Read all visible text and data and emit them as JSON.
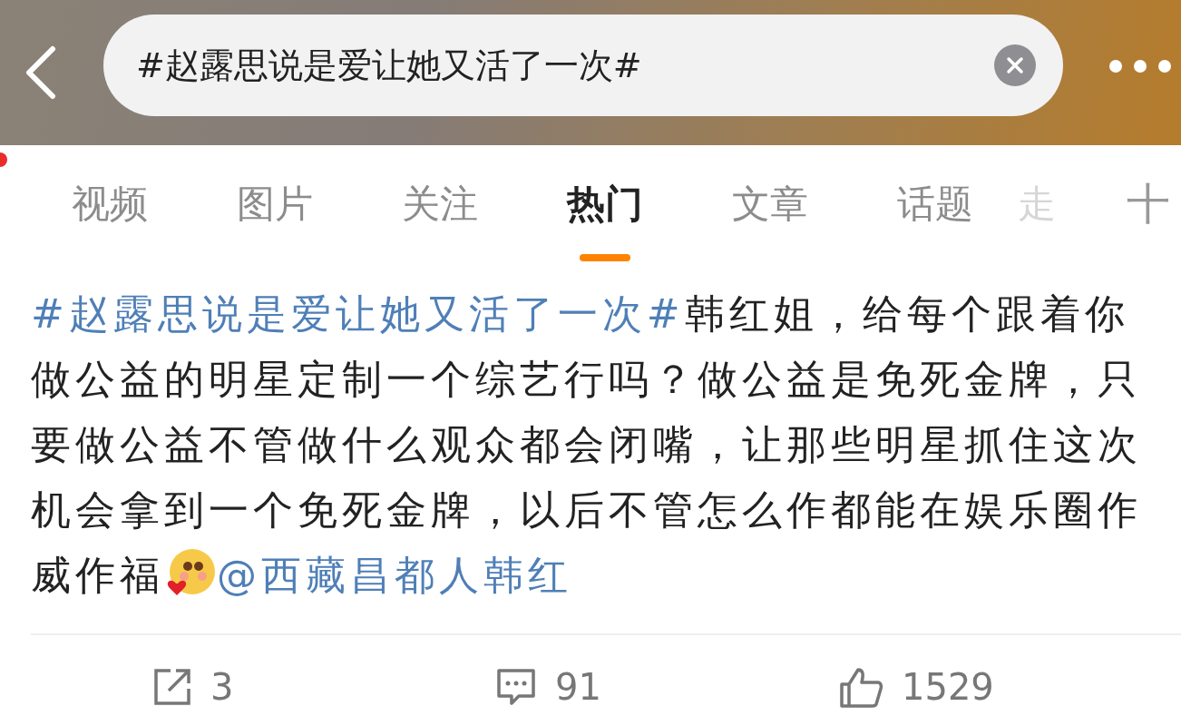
{
  "search": {
    "value": "#赵露思说是爱让她又活了一次#"
  },
  "tabs": [
    {
      "label": "视频",
      "selected": false,
      "cut": false
    },
    {
      "label": "图片",
      "selected": false,
      "cut": false
    },
    {
      "label": "关注",
      "selected": false,
      "cut": false
    },
    {
      "label": "热门",
      "selected": true,
      "cut": false
    },
    {
      "label": "文章",
      "selected": false,
      "cut": false
    },
    {
      "label": "话题",
      "selected": false,
      "cut": false
    },
    {
      "label": "走",
      "selected": false,
      "cut": true
    }
  ],
  "add_tab": {
    "label": "十"
  },
  "post": {
    "segments": [
      {
        "kind": "topic",
        "text": "#赵露思说是爱让她又活了一次#"
      },
      {
        "kind": "text",
        "text": "韩红姐，给每个跟着你做公益的明星定制一个综艺行吗？做公益是免死金牌，只要做公益不管做什么观众都会闭嘴，让那些明星抓住这次机会拿到一个免死金牌，以后不管怎么作都能在娱乐圈作威作福"
      },
      {
        "kind": "emoji"
      },
      {
        "kind": "mention",
        "text": "@西藏昌都人韩红"
      }
    ]
  },
  "actions": [
    {
      "kind": "share",
      "count": "3"
    },
    {
      "kind": "comment",
      "count": "91"
    },
    {
      "kind": "like",
      "count": "1529"
    }
  ]
}
